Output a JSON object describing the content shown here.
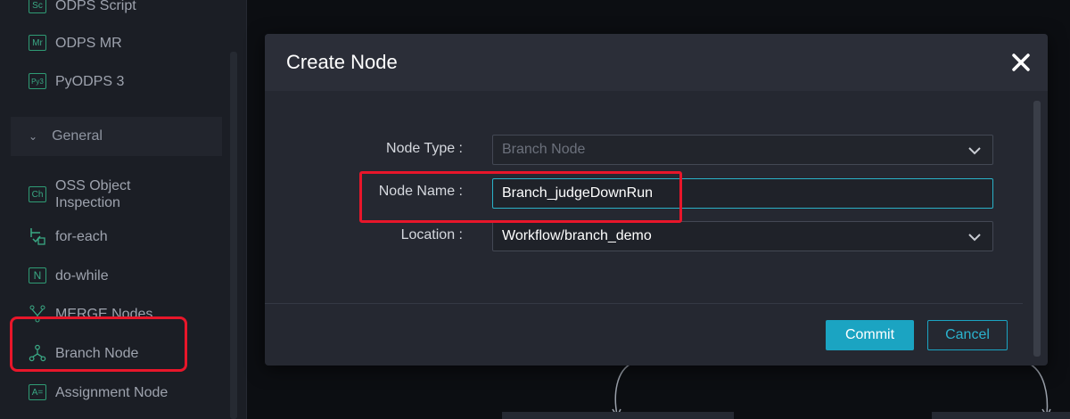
{
  "sidebar": {
    "items": [
      {
        "label": "ODPS Script",
        "icon": "Sc"
      },
      {
        "label": "ODPS MR",
        "icon": "Mr"
      },
      {
        "label": "PyODPS 3",
        "icon": "Py3"
      }
    ],
    "section": {
      "label": "General"
    },
    "general_items": [
      {
        "label": "OSS Object\nInspection",
        "icon": "Ch"
      },
      {
        "label": "for-each"
      },
      {
        "label": "do-while",
        "icon": "N"
      },
      {
        "label": "MERGE Nodes"
      },
      {
        "label": "Branch Node"
      },
      {
        "label": "Assignment Node",
        "icon": "A="
      }
    ]
  },
  "dialog": {
    "title": "Create Node",
    "fields": {
      "node_type": {
        "label": "Node Type :",
        "value": "Branch Node"
      },
      "node_name": {
        "label": "Node Name :",
        "value": "Branch_judgeDownRun"
      },
      "location": {
        "label": "Location :",
        "value": "Workflow/branch_demo"
      }
    },
    "buttons": {
      "commit": "Commit",
      "cancel": "Cancel"
    }
  },
  "colors": {
    "accent": "#1ba4c2",
    "highlight": "#e8162a",
    "icon_green": "#2f9c75"
  }
}
